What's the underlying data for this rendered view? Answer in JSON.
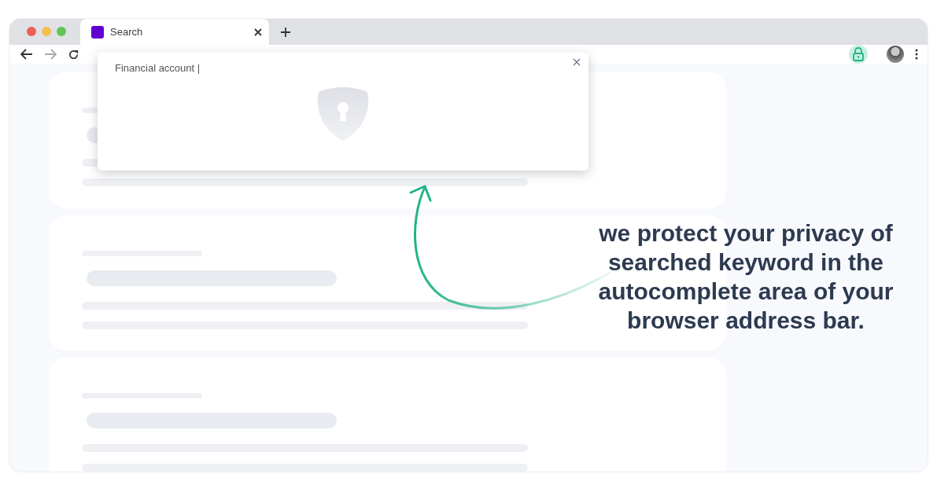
{
  "tabs": [
    {
      "label": "Search",
      "selected": true
    }
  ],
  "autocomplete": {
    "value": "Financial account |"
  },
  "message": "we protect your privacy of searched keyword in the autocomplete area of your browser address bar."
}
